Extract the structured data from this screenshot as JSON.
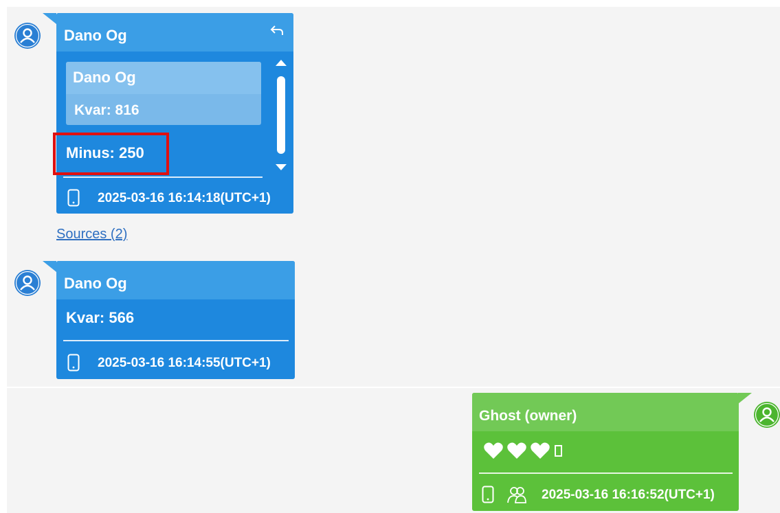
{
  "messages": [
    {
      "sender": "Dano Og",
      "quote": {
        "sender": "Dano Og",
        "text": "Kvar: 816"
      },
      "text": "Minus: 250",
      "timestamp": "2025-03-16 16:14:18(UTC+1)",
      "icons": [
        "phone-icon"
      ],
      "color": "#1e88de"
    },
    {
      "sender": "Dano Og",
      "text": "Kvar: 566",
      "timestamp": "2025-03-16 16:14:55(UTC+1)",
      "icons": [
        "phone-icon"
      ],
      "color": "#1e88de"
    },
    {
      "sender": "Ghost (owner)",
      "reactions": [
        "white-heart",
        "white-heart",
        "white-heart",
        "box-glyph"
      ],
      "timestamp": "2025-03-16 16:16:52(UTC+1)",
      "icons": [
        "phone-icon",
        "group-icon"
      ],
      "color": "#5cc13a"
    }
  ],
  "sources_link": "Sources (2)",
  "highlight_color": "#e01010"
}
